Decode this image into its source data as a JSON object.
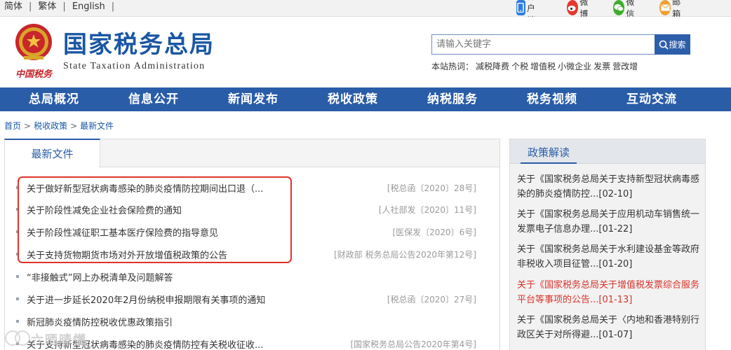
{
  "topbar": {
    "lang": [
      "简体",
      "繁体",
      "English"
    ],
    "links": [
      {
        "label": "客户端",
        "icon": "phone-icon",
        "color": "#2b7de1"
      },
      {
        "label": "微博",
        "icon": "weibo-icon",
        "color": "#e6362d"
      },
      {
        "label": "微信",
        "icon": "wechat-icon",
        "color": "#3dae2b"
      },
      {
        "label": "邮箱",
        "icon": "mail-icon",
        "color": "#f0a030"
      }
    ]
  },
  "header": {
    "emblem_text": "中国税务",
    "title_cn": "国家税务总局",
    "title_en": "State Taxation Administration",
    "search_placeholder": "请输入关键字",
    "search_button": "搜索",
    "hot_label": "本站热词：",
    "hot_words": [
      "减税降费",
      "个税",
      "增值税",
      "小微企业",
      "发票",
      "营改增"
    ]
  },
  "nav": [
    "总局概况",
    "信息公开",
    "新闻发布",
    "税收政策",
    "纳税服务",
    "税务视频",
    "互动交流"
  ],
  "breadcrumb": [
    "首页",
    "税收政策",
    "最新文件"
  ],
  "left_panel": {
    "tab": "最新文件",
    "docs": [
      {
        "title": "关于做好新型冠状病毒感染的肺炎疫情防控期间出口退（...",
        "num": "[税总函〔2020〕28号]"
      },
      {
        "title": "关于阶段性减免企业社会保险费的通知",
        "num": "[人社部发〔2020〕11号]"
      },
      {
        "title": "关于阶段性减征职工基本医疗保险费的指导意见",
        "num": "[医保发〔2020〕6号]"
      },
      {
        "title": "关于支持货物期货市场对外开放增值税政策的公告",
        "num": "[财政部 税务总局公告2020年第12号]"
      },
      {
        "title": "“非接触式”网上办税清单及问题解答",
        "num": ""
      },
      {
        "title": "关于进一步延长2020年2月份纳税申报期限有关事项的通知",
        "num": "[税总函〔2020〕27号]"
      },
      {
        "title": "新冠肺炎疫情防控税收优惠政策指引",
        "num": ""
      },
      {
        "title": "关于支持新型冠状病毒感染的肺炎疫情防控有关税收征收...",
        "num": "[国家税务总局公告2020年第4号]"
      }
    ]
  },
  "right_panel": {
    "title": "政策解读",
    "items": [
      {
        "text": "关于《国家税务总局关于支持新型冠状病毒感染的肺炎疫情防控...[02-10]",
        "highlight": false
      },
      {
        "text": "关于《国家税务总局关于应用机动车销售统一发票电子信息办理...[01-22]",
        "highlight": false
      },
      {
        "text": "关于《国家税务总局关于水利建设基金等政府非税收入项目征管...[01-20]",
        "highlight": false
      },
      {
        "text": "关于《国家税务总局关于增值税发票综合服务平台等事项的公告...[01-13]",
        "highlight": true
      },
      {
        "text": "关于《国家税务总局关于〈内地和香港特别行政区关于对所得避...[01-07]",
        "highlight": false
      }
    ]
  },
  "watermark": "六晒晴懂"
}
